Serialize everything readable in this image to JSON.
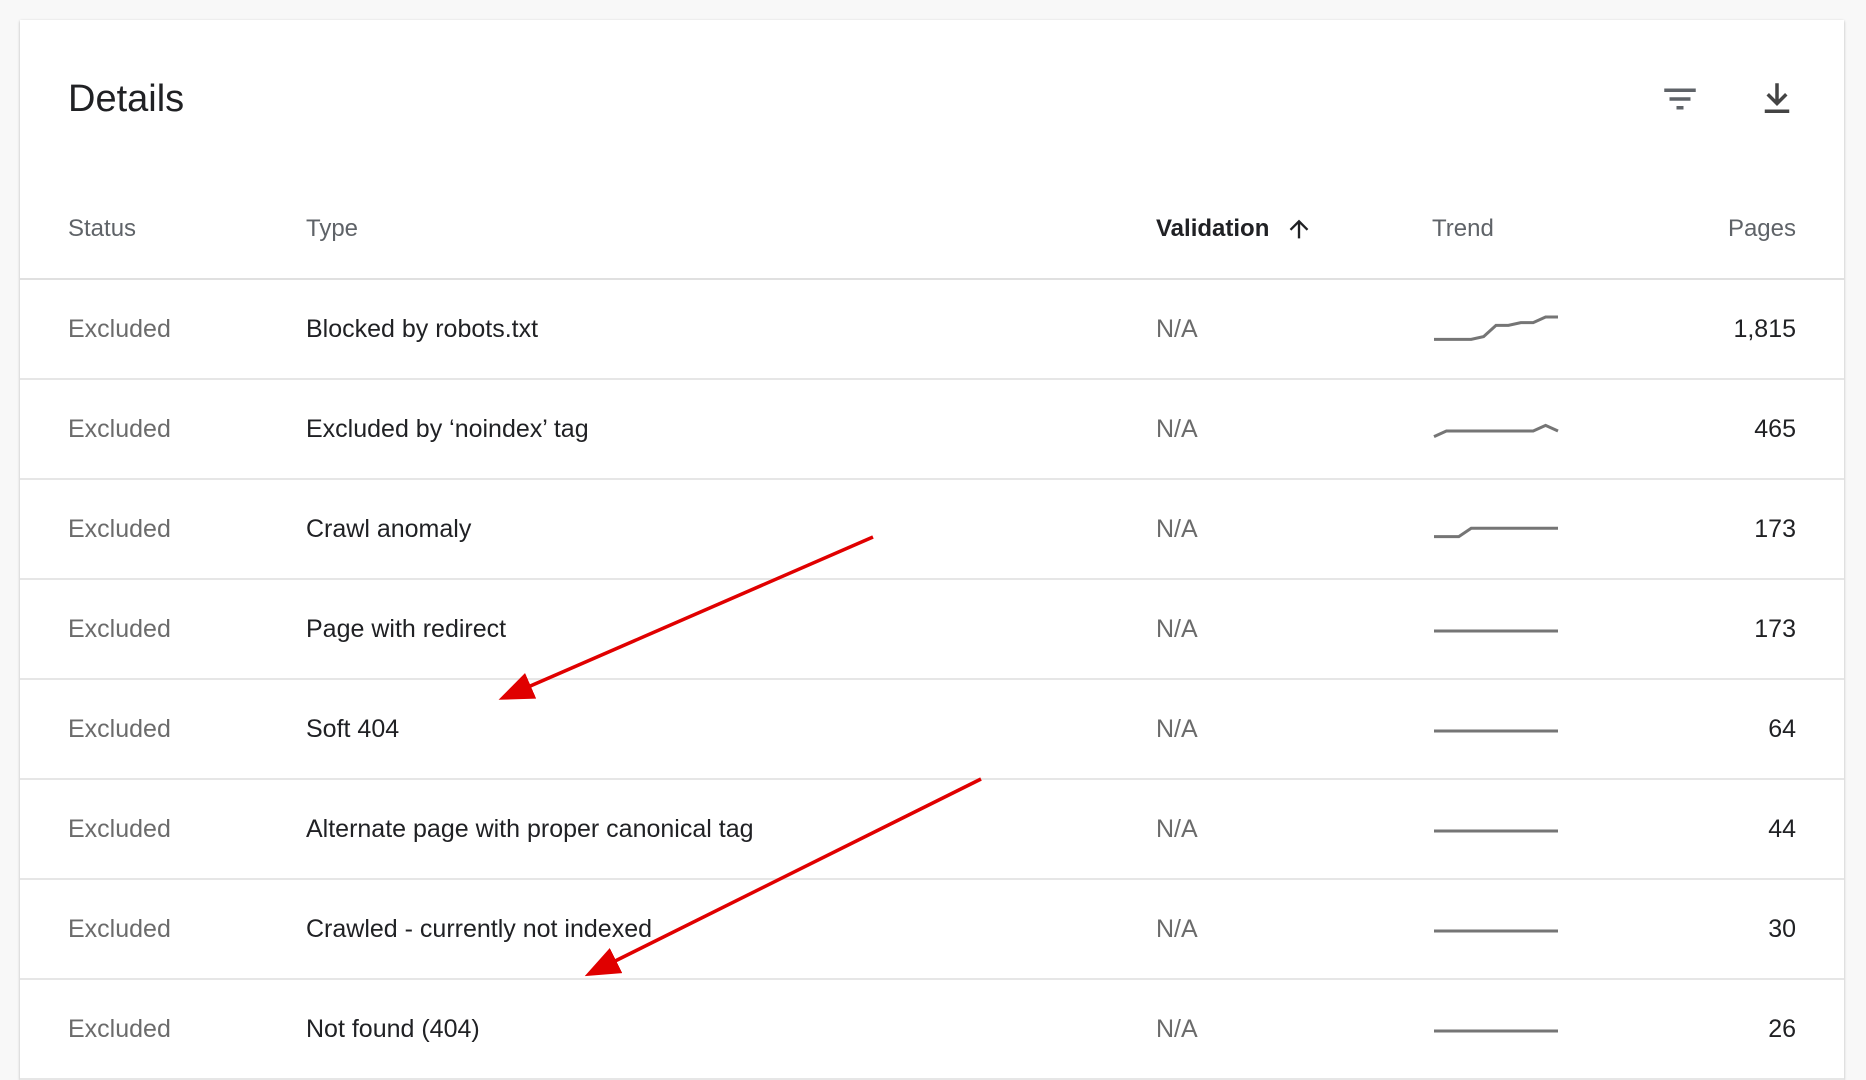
{
  "card": {
    "title": "Details"
  },
  "toolbar": {
    "filter_icon": "filter-icon",
    "download_icon": "download-icon"
  },
  "table": {
    "columns": {
      "status": "Status",
      "type": "Type",
      "validation": "Validation",
      "trend": "Trend",
      "pages": "Pages"
    },
    "sort_column": "validation",
    "sort_direction": "ascending",
    "rows": [
      {
        "status": "Excluded",
        "type": "Blocked by robots.txt",
        "validation": "N/A",
        "pages": "1,815",
        "trend": [
          0.2,
          0.2,
          0.2,
          0.2,
          0.3,
          0.7,
          0.7,
          0.8,
          0.8,
          1.0,
          1.0
        ]
      },
      {
        "status": "Excluded",
        "type": "Excluded by ‘noindex’ tag",
        "validation": "N/A",
        "pages": "465",
        "trend": [
          0.3,
          0.5,
          0.5,
          0.5,
          0.5,
          0.5,
          0.5,
          0.5,
          0.5,
          0.7,
          0.5
        ]
      },
      {
        "status": "Excluded",
        "type": "Crawl anomaly",
        "validation": "N/A",
        "pages": "173",
        "trend": [
          0.3,
          0.3,
          0.3,
          0.6,
          0.6,
          0.6,
          0.6,
          0.6,
          0.6,
          0.6,
          0.6
        ]
      },
      {
        "status": "Excluded",
        "type": "Page with redirect",
        "validation": "N/A",
        "pages": "173",
        "trend": [
          0.5,
          0.5,
          0.5,
          0.5,
          0.5,
          0.5,
          0.5,
          0.5,
          0.5,
          0.5,
          0.5
        ]
      },
      {
        "status": "Excluded",
        "type": "Soft 404",
        "validation": "N/A",
        "pages": "64",
        "trend": [
          0.5,
          0.5,
          0.5,
          0.5,
          0.5,
          0.5,
          0.5,
          0.5,
          0.5,
          0.5,
          0.5
        ]
      },
      {
        "status": "Excluded",
        "type": "Alternate page with proper canonical tag",
        "validation": "N/A",
        "pages": "44",
        "trend": [
          0.5,
          0.5,
          0.5,
          0.5,
          0.5,
          0.5,
          0.5,
          0.5,
          0.5,
          0.5,
          0.5
        ]
      },
      {
        "status": "Excluded",
        "type": "Crawled - currently not indexed",
        "validation": "N/A",
        "pages": "30",
        "trend": [
          0.5,
          0.5,
          0.5,
          0.5,
          0.5,
          0.5,
          0.5,
          0.5,
          0.5,
          0.5,
          0.5
        ]
      },
      {
        "status": "Excluded",
        "type": "Not found (404)",
        "validation": "N/A",
        "pages": "26",
        "trend": [
          0.5,
          0.5,
          0.5,
          0.5,
          0.5,
          0.5,
          0.5,
          0.5,
          0.5,
          0.5,
          0.5
        ]
      }
    ]
  },
  "annotation_arrows": {
    "color": "#e00000",
    "targets": [
      "Soft 404",
      "Not found (404)"
    ]
  }
}
